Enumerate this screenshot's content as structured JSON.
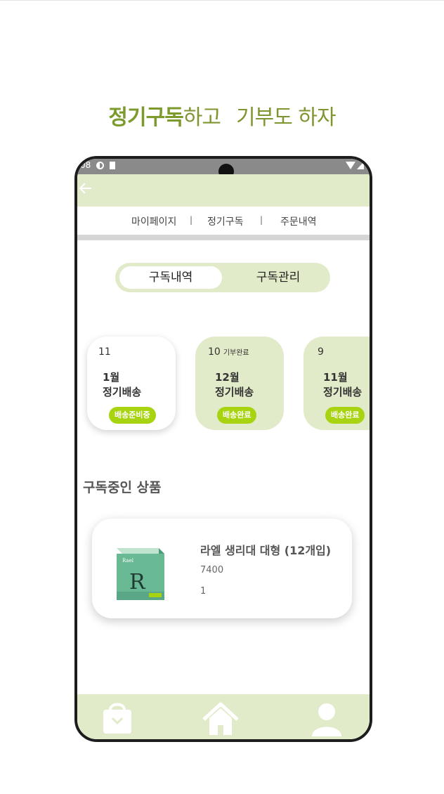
{
  "headline": {
    "bold_part": "정기구독",
    "part2": "하고",
    "part3": "기부도 하자"
  },
  "status_bar": {
    "time": "08"
  },
  "tabs": [
    {
      "label": "마이페이지"
    },
    {
      "label": "정기구독"
    },
    {
      "label": "주문내역"
    }
  ],
  "tab_separator": "|",
  "segmented": {
    "selected": "구독내역",
    "other": "구독관리"
  },
  "deliveries": [
    {
      "day": "11",
      "donation": "",
      "month": "1월",
      "type": "정기배송",
      "status": "배송준비중"
    },
    {
      "day": "10",
      "donation": "기부완료",
      "month": "12월",
      "type": "정기배송",
      "status": "배송완료"
    },
    {
      "day": "9",
      "donation": "",
      "month": "11월",
      "type": "정기배송",
      "status": "배송완료"
    }
  ],
  "section_title": "구독중인 상품",
  "product": {
    "name": "라엘 생리대 대형 (12개입)",
    "price": "7400",
    "quantity": "1",
    "box_brand": "Rael",
    "box_letter": "R"
  },
  "colors": {
    "accent": "#a8d310",
    "pale_green": "#e2ebc9",
    "headline": "#7f9630"
  },
  "icons": [
    "back-arrow-icon",
    "shopping-bag-icon",
    "home-icon",
    "user-icon"
  ]
}
